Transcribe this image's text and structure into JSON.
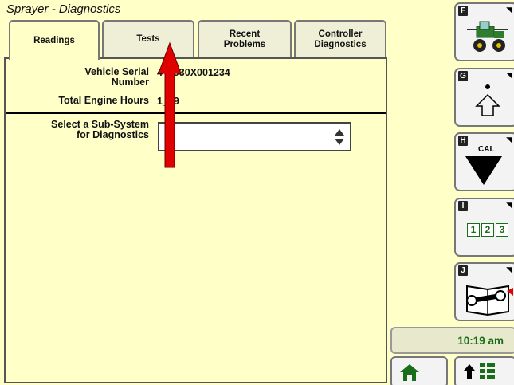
{
  "window": {
    "title": "Sprayer - Diagnostics"
  },
  "tabs": [
    {
      "label": "Readings"
    },
    {
      "label": "Tests"
    },
    {
      "label": "Recent Problems"
    },
    {
      "label": "Controller Diagnostics"
    }
  ],
  "readings": {
    "serial_label": "Vehicle Serial Number",
    "serial_value": "4__930X001234",
    "hours_label": "Total Engine Hours",
    "hours_value": "1__9",
    "subsystem_label": "Select a Sub-System for Diagnostics",
    "subsystem_value": "-"
  },
  "softkeys": [
    {
      "letter": "F",
      "icon": "sprayer-vehicle-icon"
    },
    {
      "letter": "G",
      "icon": "shift-up-icon"
    },
    {
      "letter": "H",
      "icon": "cal-down-icon",
      "label": "CAL"
    },
    {
      "letter": "I",
      "icon": "numeric-entry-icon",
      "numbers": [
        "1",
        "2",
        "3"
      ]
    },
    {
      "letter": "J",
      "icon": "service-manual-icon"
    }
  ],
  "status": {
    "time": "10:19 am"
  },
  "colors": {
    "background": "#FFFFC8",
    "accent_green": "#1a6d1a",
    "arrow_red": "#E00000"
  }
}
